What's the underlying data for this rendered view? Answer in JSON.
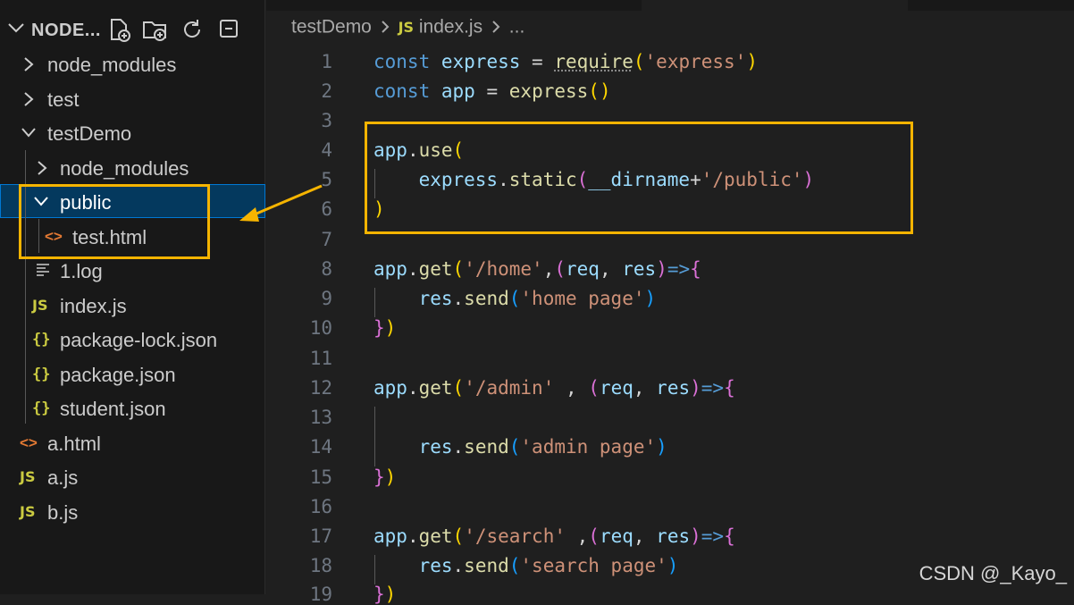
{
  "explorer": {
    "title": "NODE...",
    "tree": [
      {
        "label": "node_modules",
        "kind": "folder",
        "expanded": false
      },
      {
        "label": "test",
        "kind": "folder",
        "expanded": false
      },
      {
        "label": "testDemo",
        "kind": "folder",
        "expanded": true
      },
      {
        "label": "node_modules",
        "kind": "folder",
        "expanded": false
      },
      {
        "label": "public",
        "kind": "folder",
        "expanded": true,
        "selected": true
      },
      {
        "label": "test.html",
        "kind": "html",
        "icon": "<>"
      },
      {
        "label": "1.log",
        "kind": "log"
      },
      {
        "label": "index.js",
        "kind": "js",
        "icon": "JS"
      },
      {
        "label": "package-lock.json",
        "kind": "json",
        "icon": "{}"
      },
      {
        "label": "package.json",
        "kind": "json",
        "icon": "{}"
      },
      {
        "label": "student.json",
        "kind": "json",
        "icon": "{}"
      },
      {
        "label": "a.html",
        "kind": "html",
        "icon": "<>"
      },
      {
        "label": "a.js",
        "kind": "js",
        "icon": "JS"
      },
      {
        "label": "b.js",
        "kind": "js",
        "icon": "JS"
      }
    ]
  },
  "breadcrumb": {
    "folder": "testDemo",
    "file_icon": "JS",
    "file": "index.js",
    "more": "..."
  },
  "editor": {
    "line_numbers": [
      "1",
      "2",
      "3",
      "4",
      "5",
      "6",
      "7",
      "8",
      "9",
      "10",
      "11",
      "12",
      "13",
      "14",
      "15",
      "16",
      "17",
      "18",
      "19"
    ]
  },
  "watermark": "CSDN @_Kayo_",
  "colors": {
    "highlight": "#f5b400",
    "selection": "#04395e",
    "accent": "#0078d4"
  }
}
